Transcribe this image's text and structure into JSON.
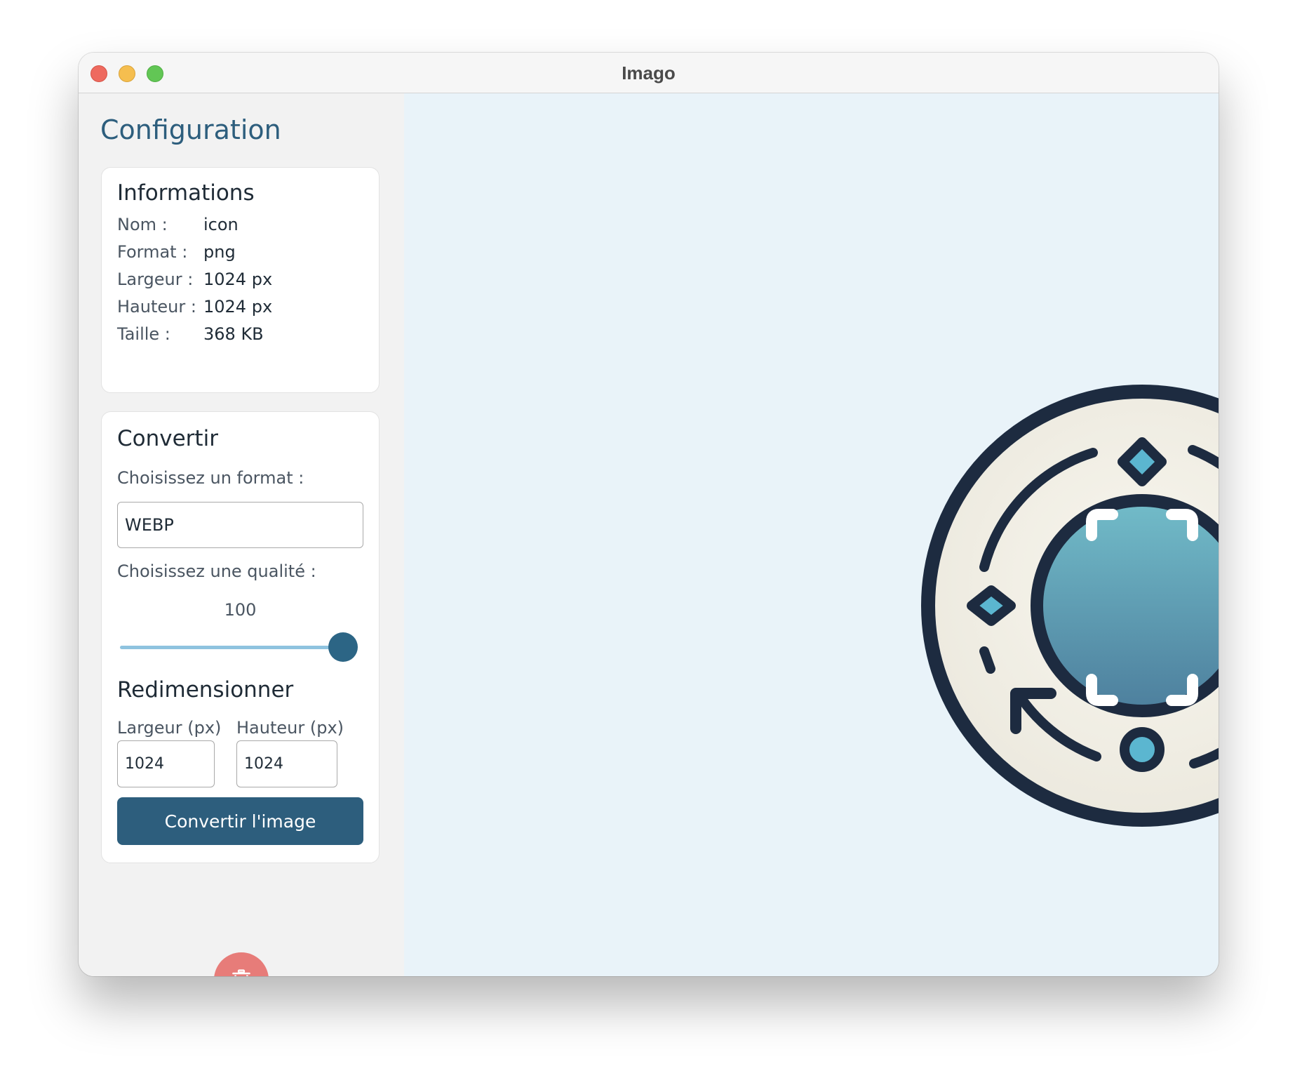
{
  "window": {
    "title": "Imago"
  },
  "sidebar": {
    "title": "Configuration",
    "info": {
      "title": "Informations",
      "rows": [
        {
          "label": "Nom :",
          "value": "icon"
        },
        {
          "label": "Format :",
          "value": "png"
        },
        {
          "label": "Largeur :",
          "value": "1024 px"
        },
        {
          "label": "Hauteur :",
          "value": "1024 px"
        },
        {
          "label": "Taille :",
          "value": "368 KB"
        }
      ]
    },
    "convert": {
      "title": "Convertir",
      "format_label": "Choisissez un format :",
      "format_value": "WEBP",
      "quality_label": "Choisissez une qualité :",
      "quality_value": "100",
      "quality_level": 1.0
    },
    "resize": {
      "title": "Redimensionner",
      "width_label": "Largeur (px)",
      "width_value": "1024",
      "height_label": "Hauteur (px)",
      "height_value": "1024"
    },
    "convert_button": "Convertir l'image",
    "delete_icon": "trash-icon"
  },
  "preview": {
    "icon": "image-convert-icon"
  },
  "colors": {
    "accent": "#2d5e7d",
    "preview_background": "#e9f3f9",
    "delete": "#e77c79",
    "slider_track": "#8ec3df"
  }
}
